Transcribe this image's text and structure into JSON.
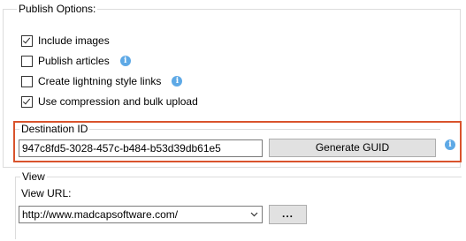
{
  "publish_options": {
    "title": "Publish Options:",
    "options": [
      {
        "label": "Include images",
        "checked": true,
        "info": false
      },
      {
        "label": "Publish articles",
        "checked": false,
        "info": true
      },
      {
        "label": "Create lightning style links",
        "checked": false,
        "info": true
      },
      {
        "label": "Use compression and bulk upload",
        "checked": true,
        "info": false
      }
    ],
    "info_glyph": "i"
  },
  "destination": {
    "title": "Destination ID",
    "value": "947c8fd5-3028-457c-b484-b53d39db61e5",
    "generate_label": "Generate GUID",
    "highlight_color": "#d9532c"
  },
  "view": {
    "title": "View",
    "url_label": "View URL:",
    "url_value": "http://www.madcapsoftware.com/",
    "browse_label": "..."
  }
}
